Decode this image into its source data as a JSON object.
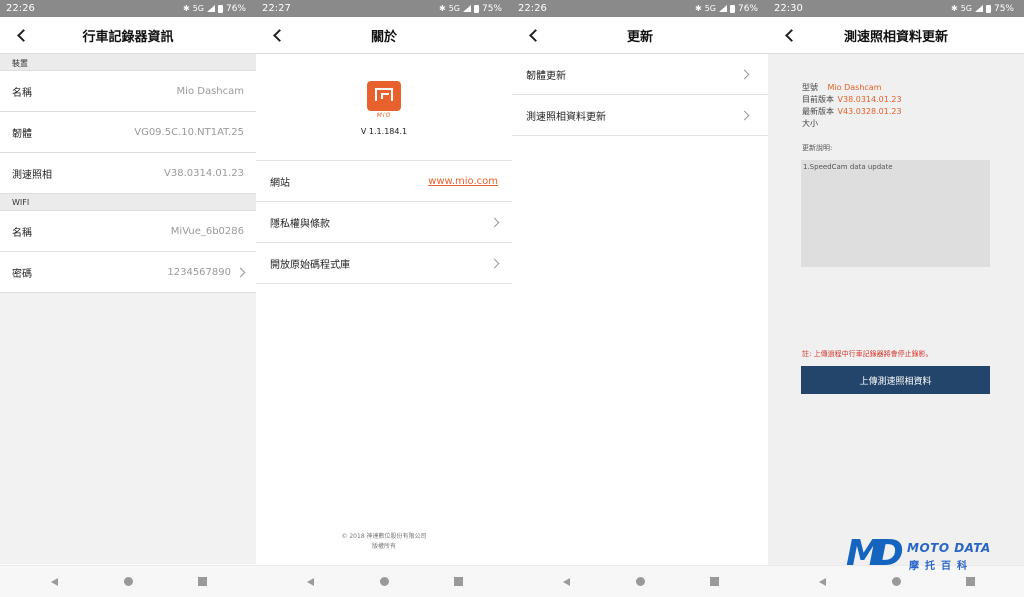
{
  "panels": [
    {
      "status": {
        "time": "22:26",
        "network": "5G",
        "battery": "76%"
      },
      "title": "行車記錄器資訊",
      "sections": [
        {
          "header": "裝置",
          "rows": [
            {
              "label": "名稱",
              "value": "Mio Dashcam"
            },
            {
              "label": "韌體",
              "value": "VG09.5C.10.NT1AT.25"
            },
            {
              "label": "測速照相",
              "value": "V38.0314.01.23"
            }
          ]
        },
        {
          "header": "WIFI",
          "rows": [
            {
              "label": "名稱",
              "value": "MiVue_6b0286"
            },
            {
              "label": "密碼",
              "value": "1234567890"
            }
          ]
        }
      ]
    },
    {
      "status": {
        "time": "22:27",
        "network": "5G",
        "battery": "75%"
      },
      "title": "關於",
      "logo_text": "MIO",
      "version": "V 1.1.184.1",
      "website_label": "網站",
      "website_link": "www.mio.com",
      "privacy_label": "隱私權與條款",
      "opensource_label": "開放原始碼程式庫",
      "footer_line1": "© 2018 神達數位股份有限公司",
      "footer_line2": "版權所有"
    },
    {
      "status": {
        "time": "22:26",
        "network": "5G",
        "battery": "76%"
      },
      "title": "更新",
      "items": [
        "韌體更新",
        "測速照相資料更新"
      ]
    },
    {
      "status": {
        "time": "22:30",
        "network": "5G",
        "battery": "75%"
      },
      "title": "測速照相資料更新",
      "model_label": "型號",
      "model_value": "Mio Dashcam",
      "current_label": "目前版本",
      "current_value": "V38.0314.01.23",
      "latest_label": "最新版本",
      "latest_value": "V43.0328.01.23",
      "size_label": "大小",
      "notes_label": "更新說明:",
      "notes_text": "1.SpeedCam data update",
      "warning": "註: 上傳過程中行車記錄器將會停止錄影。",
      "upload_button": "上傳測速照相資料"
    }
  ],
  "watermark": {
    "brand": "MOTO DATA",
    "sub": "摩托百科",
    "logo_letters": "MD"
  },
  "colors": {
    "accent": "#e8612c",
    "button": "#24456b",
    "warning": "#d9342b",
    "watermark": "#2a66c9"
  },
  "icons": {
    "back": "chevron-left-icon",
    "row_arrow": "chevron-right-icon",
    "nav_back": "triangle-back-icon",
    "nav_home": "circle-home-icon",
    "nav_recent": "square-recent-icon"
  }
}
